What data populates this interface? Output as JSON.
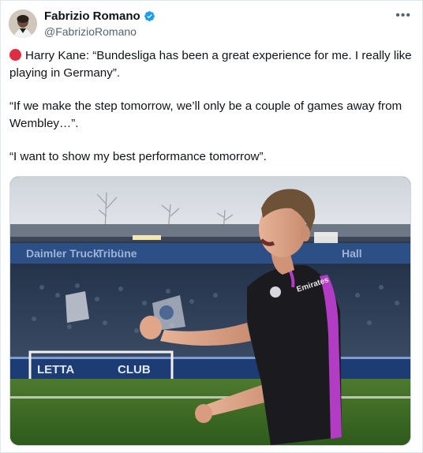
{
  "author": {
    "name": "Fabrizio Romano",
    "handle": "@FabrizioRomano",
    "verified": true
  },
  "icons": {
    "avatar": "avatar-photo",
    "verified": "verified-badge-icon",
    "more": "more-options-icon",
    "status": "red-circle-icon"
  },
  "tweet": {
    "line1": "Harry Kane: “Bundesliga has been a great experience for me. I really like playing in Germany”.",
    "line2": "“If we make the step tomorrow, we’ll only be a couple of games away from Wembley…”.",
    "line3": "“I want to show my best performance tomorrow”."
  },
  "media": {
    "signage": {
      "left_board": "LETTA",
      "center_board": "CLUB"
    }
  },
  "colors": {
    "text": "#0f1419",
    "secondary": "#536471",
    "verified": "#1d9bf0",
    "red_dot": "#dd2e44",
    "kit_magenta": "#b23cc4"
  }
}
